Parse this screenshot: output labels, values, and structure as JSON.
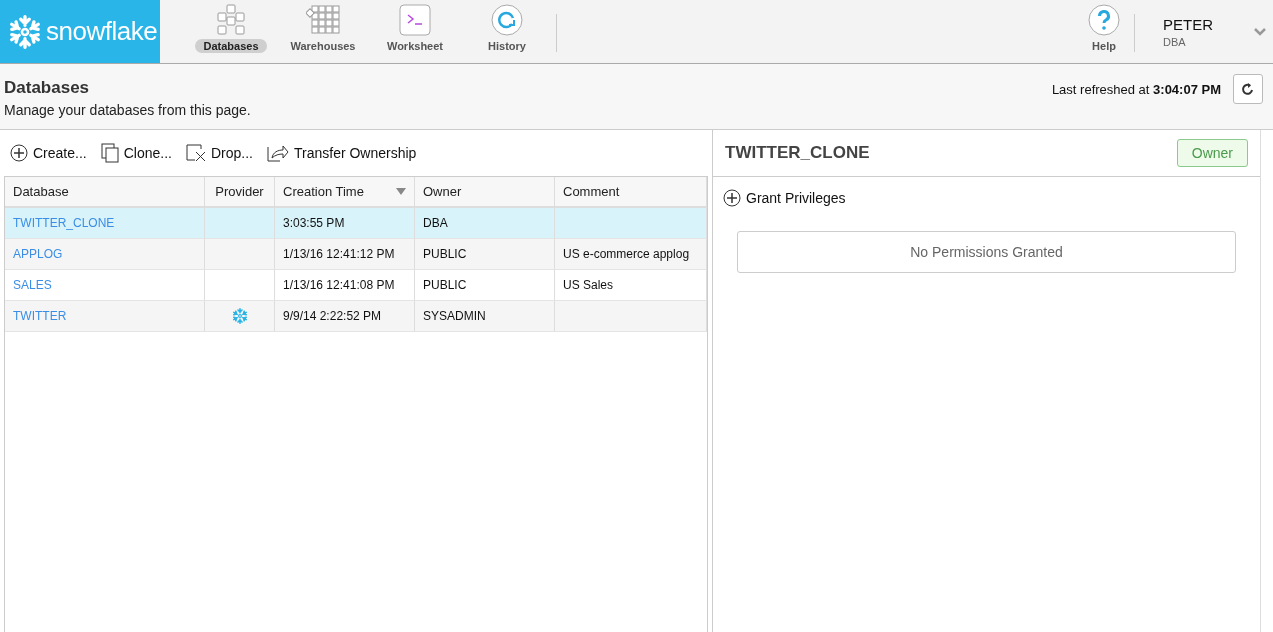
{
  "logo": {
    "text": "snowflake"
  },
  "nav": [
    {
      "label": "Databases",
      "selected": true
    },
    {
      "label": "Warehouses",
      "selected": false
    },
    {
      "label": "Worksheet",
      "selected": false
    },
    {
      "label": "History",
      "selected": false
    }
  ],
  "help": {
    "label": "Help"
  },
  "user": {
    "name": "PETER",
    "role": "DBA"
  },
  "page": {
    "title": "Databases",
    "subtitle": "Manage your databases from this page.",
    "refreshed_label": "Last refreshed at",
    "refreshed_time": "3:04:07 PM"
  },
  "actions": [
    {
      "label": "Create..."
    },
    {
      "label": "Clone..."
    },
    {
      "label": "Drop..."
    },
    {
      "label": "Transfer Ownership"
    }
  ],
  "table": {
    "columns": [
      {
        "label": "Database",
        "sorted": false
      },
      {
        "label": "Provider",
        "sorted": false
      },
      {
        "label": "Creation Time",
        "sorted": true
      },
      {
        "label": "Owner",
        "sorted": false
      },
      {
        "label": "Comment",
        "sorted": false
      }
    ],
    "rows": [
      {
        "database": "TWITTER_CLONE",
        "shared": false,
        "created": "3:03:55 PM",
        "owner": "DBA",
        "comment": "",
        "selected": true
      },
      {
        "database": "APPLOG",
        "shared": false,
        "created": "1/13/16 12:41:12 PM",
        "owner": "PUBLIC",
        "comment": "US e-commerce applog",
        "selected": false
      },
      {
        "database": "SALES",
        "shared": false,
        "created": "1/13/16 12:41:08 PM",
        "owner": "PUBLIC",
        "comment": "US Sales",
        "selected": false
      },
      {
        "database": "TWITTER",
        "shared": true,
        "created": "9/9/14 2:22:52 PM",
        "owner": "SYSADMIN",
        "comment": "",
        "selected": false
      }
    ]
  },
  "detail": {
    "title": "TWITTER_CLONE",
    "badge": "Owner",
    "grant": "Grant Privileges",
    "empty": "No Permissions Granted"
  }
}
